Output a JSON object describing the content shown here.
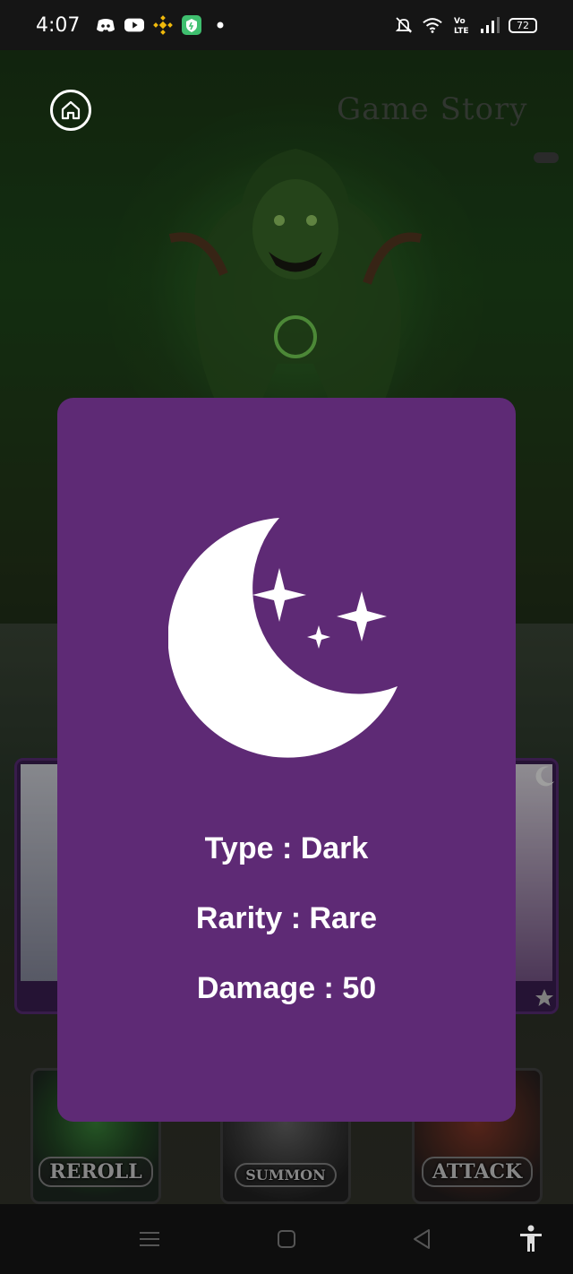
{
  "status_bar": {
    "time": "4:07",
    "battery": "72",
    "left_icons": [
      "discord-icon",
      "youtube-icon",
      "binance-icon",
      "vpn-icon",
      "dot-icon"
    ],
    "right_icons": [
      "bell-off-icon",
      "wifi-icon",
      "volte-icon",
      "signal-icon",
      "battery-icon"
    ]
  },
  "header": {
    "title": "Game Story"
  },
  "modal": {
    "icon": "moon-stars-icon",
    "type_text": "Type : Dark",
    "rarity_text": "Rarity : Rare",
    "damage_text": "Damage : 50",
    "background_color": "#5e2a75"
  },
  "actions": {
    "reroll_label": "REROLL",
    "summon_label": "SUMMON",
    "attack_label": "ATTACK"
  },
  "nav_bar": {
    "icons": [
      "menu-icon",
      "home-square-icon",
      "back-icon",
      "accessibility-icon"
    ]
  }
}
